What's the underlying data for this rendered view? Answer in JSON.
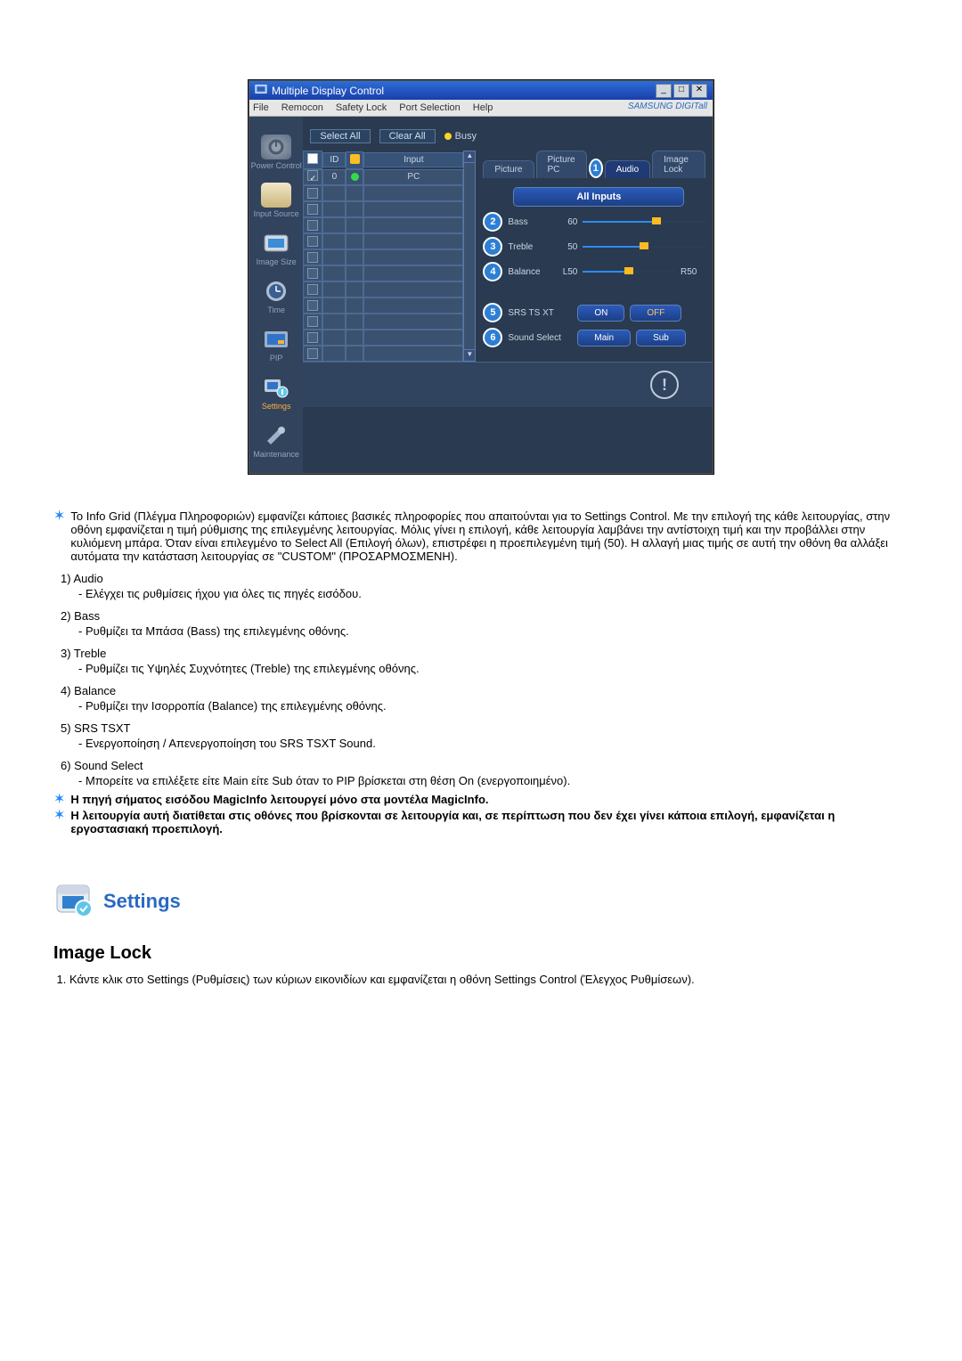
{
  "app": {
    "title": "Multiple Display Control",
    "brand": "SAMSUNG DIGITall",
    "menus": [
      "File",
      "Remocon",
      "Safety Lock",
      "Port Selection",
      "Help"
    ],
    "window_buttons": [
      "_",
      "□",
      "✕"
    ]
  },
  "sidebar": {
    "items": [
      {
        "label": "Power Control"
      },
      {
        "label": "Input Source"
      },
      {
        "label": "Image Size"
      },
      {
        "label": "Time"
      },
      {
        "label": "PIP"
      },
      {
        "label": "Settings",
        "highlight": true
      },
      {
        "label": "Maintenance"
      }
    ]
  },
  "toolbar": {
    "select_all": "Select All",
    "clear_all": "Clear All",
    "busy": "Busy"
  },
  "grid": {
    "headers": {
      "id": "ID",
      "input": "Input"
    },
    "row0": {
      "id": "0",
      "input": "PC"
    }
  },
  "settings_tabs": {
    "picture": "Picture",
    "picture_pc": "Picture PC",
    "audio": "Audio",
    "image_lock": "Image Lock",
    "all_inputs": "All Inputs"
  },
  "audio": {
    "bass": {
      "label": "Bass",
      "value": "60",
      "pct": 60
    },
    "treble": {
      "label": "Treble",
      "value": "50",
      "pct": 50
    },
    "balance": {
      "label": "Balance",
      "value": "L50",
      "endlabel": "R50",
      "pct": 50
    },
    "srs": {
      "label": "SRS TS XT",
      "on": "ON",
      "off": "OFF"
    },
    "sound_select": {
      "label": "Sound Select",
      "main": "Main",
      "sub": "Sub"
    }
  },
  "numbers": {
    "n1": "1",
    "n2": "2",
    "n3": "3",
    "n4": "4",
    "n5": "5",
    "n6": "6"
  },
  "text": {
    "star1": "Το Info Grid (Πλέγμα Πληροφοριών) εμφανίζει κάποιες βασικές πληροφορίες που απαιτούνται για το Settings Control. Με την επιλογή της κάθε λειτουργίας, στην οθόνη εμφανίζεται η τιμή ρύθμισης της επιλεγμένης λειτουργίας. Μόλις γίνει η επιλογή, κάθε λειτουργία λαμβάνει την αντίστοιχη τιμή και την προβάλλει στην κυλιόμενη μπάρα. Όταν είναι επιλεγμένο το Select All (Επιλογή όλων), επιστρέφει η προεπιλεγμένη τιμή (50). Η αλλαγή μιας τιμής σε αυτή την οθόνη θα αλλάξει αυτόματα την κατάσταση λειτουργίας σε \"CUSTOM\" (ΠΡΟΣΑΡΜΟΣΜΕΝΗ).",
    "i1_t": "1)  Audio",
    "i1_s": "- Ελέγχει τις ρυθμίσεις ήχου για όλες τις πηγές εισόδου.",
    "i2_t": "2)  Bass",
    "i2_s": "- Ρυθμίζει τα Μπάσα (Bass) της επιλεγμένης οθόνης.",
    "i3_t": "3)  Treble",
    "i3_s": "- Ρυθμίζει τις Υψηλές Συχνότητες (Treble) της επιλεγμένης οθόνης.",
    "i4_t": "4)  Balance",
    "i4_s": "- Ρυθμίζει την Ισορροπία (Balance) της επιλεγμένης οθόνης.",
    "i5_t": "5)  SRS TSXT",
    "i5_s": "- Ενεργοποίηση / Απενεργοποίηση του SRS TSXT Sound.",
    "i6_t": "6)  Sound Select",
    "i6_s": "- Μπορείτε να επιλέξετε είτε Main είτε Sub όταν το PIP βρίσκεται στη θέση On (ενεργοποιημένο).",
    "star2": "Η πηγή σήματος εισόδου MagicInfo λειτουργεί μόνο στα μοντέλα MagicInfo.",
    "star3": "Η λειτουργία αυτή διατίθεται στις οθόνες που βρίσκονται σε λειτουργία και, σε περίπτωση που δεν έχει γίνει κάποια επιλογή, εμφανίζεται η εργοστασιακή προεπιλογή.",
    "settings_title": "Settings",
    "image_lock_title": "Image Lock",
    "il_1": "Κάντε κλικ στο Settings (Ρυθμίσεις) των κύριων εικονιδίων και εμφανίζεται η οθόνη Settings Control (Έλεγχος Ρυθμίσεων)."
  }
}
